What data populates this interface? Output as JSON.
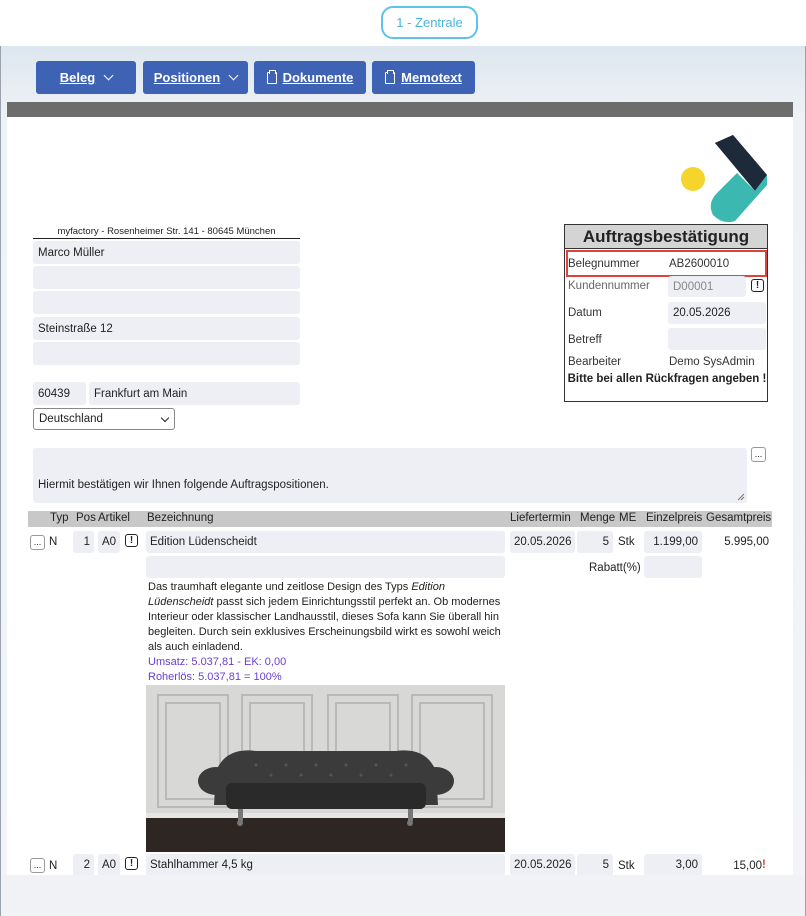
{
  "header": {
    "company": "1 - Zentrale"
  },
  "toolbar": {
    "beleg": "Beleg",
    "positionen": "Positionen",
    "dokumente": "Dokumente",
    "memotext": "Memotext"
  },
  "address": {
    "sender_line": "myfactory - Rosenheimer Str. 141 - 80645 München",
    "name": "Marco Müller",
    "line2": "",
    "line3": "",
    "street": "Steinstraße 12",
    "line5": "",
    "zip": "60439",
    "city": "Frankfurt am Main",
    "country": "Deutschland"
  },
  "docbox": {
    "title": "Auftragsbestätigung",
    "belegnummer_label": "Belegnummer",
    "belegnummer_value": "AB2600010",
    "kundennummer_label": "Kundennummer",
    "kundennummer_value": "D00001",
    "datum_label": "Datum",
    "datum_value": "20.05.2026",
    "betreff_label": "Betreff",
    "betreff_value": "",
    "bearbeiter_label": "Bearbeiter",
    "bearbeiter_value": "Demo SysAdmin",
    "note": "Bitte bei allen Rückfragen angeben !"
  },
  "intro_text": "Hiermit bestätigen wir Ihnen folgende Auftragspositionen.",
  "table": {
    "headers": {
      "typ": "Typ",
      "pos": "Pos",
      "artikel": "Artikel",
      "bezeichnung": "Bezeichnung",
      "liefertermin": "Liefertermin",
      "menge": "Menge",
      "me": "ME",
      "einzelpreis": "Einzelpreis",
      "gesamtpreis": "Gesamtpreis"
    },
    "rows": [
      {
        "typ": "N",
        "pos": "1",
        "artikel": "A0",
        "bezeichnung": "Edition Lüdenscheidt",
        "liefertermin": "20.05.2026",
        "menge": "5",
        "me": "Stk",
        "einzelpreis": "1.199,00",
        "gesamtpreis": "5.995,00",
        "rabatt_label": "Rabatt(%)",
        "desc_pre": "Das traumhaft elegante und zeitlose Design des Typs ",
        "desc_italic": "Edition Lüdenscheidt",
        "desc_post": " passt sich jedem Einrichtungsstil perfekt an. Ob modernes Interieur oder klassischer Landhausstil, dieses Sofa kann Sie überall hin begleiten. Durch sein exklusives Erscheinungsbild wirkt es sowohl weich als auch einladend.",
        "umsatz": "Umsatz: 5.037,81 - EK: 0,00",
        "rohertrag": "Roherlös: 5.037,81 = 100%"
      },
      {
        "typ": "N",
        "pos": "2",
        "artikel": "A0",
        "bezeichnung": "Stahlhammer 4,5 kg",
        "liefertermin": "20.05.2026",
        "menge": "5",
        "me": "Stk",
        "einzelpreis": "3,00",
        "gesamtpreis": "15,00"
      }
    ]
  },
  "colors": {
    "button": "#3e63b5",
    "pill": "#5ec3e8",
    "highlight": "#e0413b",
    "logo_dark": "#1d2a3a",
    "logo_teal": "#3bb8b0",
    "logo_yellow": "#f5d42b"
  }
}
